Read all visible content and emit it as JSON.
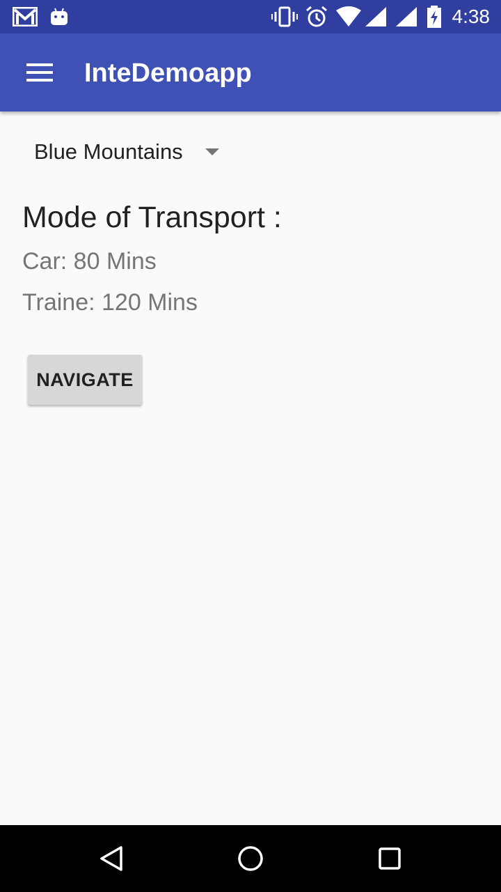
{
  "status_bar": {
    "time": "4:38",
    "icons": [
      "gmail-icon",
      "android-icon",
      "vibrate-icon",
      "alarm-icon",
      "wifi-icon",
      "signal-icon",
      "signal-icon",
      "battery-charging-icon"
    ]
  },
  "app_bar": {
    "title": "InteDemoapp",
    "menu_icon": "menu-icon",
    "color": "#3f51b5"
  },
  "spinner": {
    "selected": "Blue Mountains"
  },
  "main": {
    "heading": "Mode of Transport :",
    "car": "Car: 80 Mins",
    "train": "Traine: 120 Mins",
    "navigate_label": "NAVIGATE"
  },
  "nav_bar": {
    "buttons": [
      "back-icon",
      "home-icon",
      "recents-icon"
    ]
  },
  "colors": {
    "status_bar": "#303f9f",
    "app_bar": "#3f51b5",
    "background": "#fafafa",
    "button": "#d6d7d7"
  }
}
